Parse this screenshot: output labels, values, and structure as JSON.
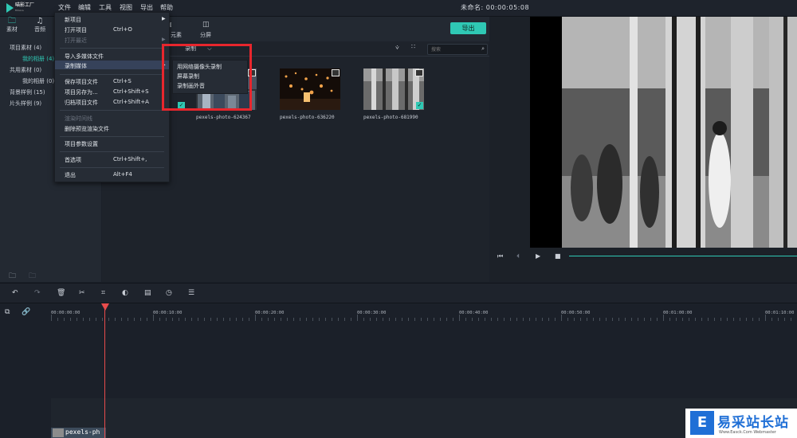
{
  "app": {
    "logo_text": "喵影工厂",
    "logo_sub": "filmora",
    "title_time": "未命名: 00:00:05:08"
  },
  "menubar": [
    "文件",
    "编辑",
    "工具",
    "视图",
    "导出",
    "帮助"
  ],
  "left_tabs": [
    {
      "label": "素材",
      "icon": "folder-icon"
    },
    {
      "label": "音频",
      "icon": "music-note-icon"
    }
  ],
  "tree": [
    {
      "label": "项目素材 (4)",
      "selected": false
    },
    {
      "label": "我的相册 (4)",
      "selected": true
    },
    {
      "label": "共用素材 (0)",
      "selected": false
    },
    {
      "label": "我的相册 (0)",
      "selected": false
    },
    {
      "label": "背景样例 (15)",
      "selected": false
    },
    {
      "label": "片头样例 (9)",
      "selected": false
    }
  ],
  "toolbar_tabs": [
    {
      "label": "元素",
      "icon": "elements-icon"
    },
    {
      "label": "分屏",
      "icon": "split-screen-icon"
    }
  ],
  "export_label": "导出",
  "record_dropdown": "录制",
  "search": {
    "placeholder": "搜索"
  },
  "thumbnails": [
    {
      "label": "pexels-photo-624367",
      "checked": true,
      "fragment": "5"
    },
    {
      "label": "pexels-photo-636220",
      "checked": false
    },
    {
      "label": "pexels-photo-681990",
      "checked": true
    }
  ],
  "file_menu": {
    "items": [
      {
        "label": "新项目",
        "shortcut": "",
        "disabled": false,
        "submenu": true
      },
      {
        "label": "打开项目",
        "shortcut": "Ctrl+O",
        "disabled": false
      },
      {
        "label": "打开最近",
        "shortcut": "",
        "disabled": true,
        "submenu": true
      },
      {
        "label": "导入多媒体文件",
        "shortcut": "",
        "disabled": false
      },
      {
        "label": "录制媒体",
        "shortcut": "",
        "disabled": false,
        "highlighted": true
      },
      {
        "label": "保存项目文件",
        "shortcut": "Ctrl+S",
        "disabled": false
      },
      {
        "label": "项目另存为...",
        "shortcut": "Ctrl+Shift+S",
        "disabled": false
      },
      {
        "label": "归档项目文件",
        "shortcut": "Ctrl+Shift+A",
        "disabled": false
      },
      {
        "label": "渲染时间线",
        "shortcut": "",
        "disabled": true
      },
      {
        "label": "删除预览渲染文件",
        "shortcut": "",
        "disabled": false
      },
      {
        "label": "项目参数设置",
        "shortcut": "",
        "disabled": false
      },
      {
        "label": "首选项",
        "shortcut": "Ctrl+Shift+,",
        "disabled": false
      },
      {
        "label": "退出",
        "shortcut": "Alt+F4",
        "disabled": false
      }
    ]
  },
  "record_submenu": [
    "用网络摄像头录制",
    "屏幕录制",
    "录制画外音"
  ],
  "timeline": {
    "timecodes": [
      "00:00:00:00",
      "00:00:10:00",
      "00:00:20:00",
      "00:00:30:00",
      "00:00:40:00",
      "00:00:50:00",
      "00:01:00:00",
      "00:01:10:00"
    ],
    "clip_label": "pexels-ph"
  },
  "watermark": {
    "text": "易采站长站",
    "url": "Www.Easck.Com  Webmaster",
    "logo_char": "E"
  },
  "colors": {
    "accent": "#2fc8b4",
    "playhead": "#e84c4c",
    "highlight_box": "#e8262d"
  }
}
